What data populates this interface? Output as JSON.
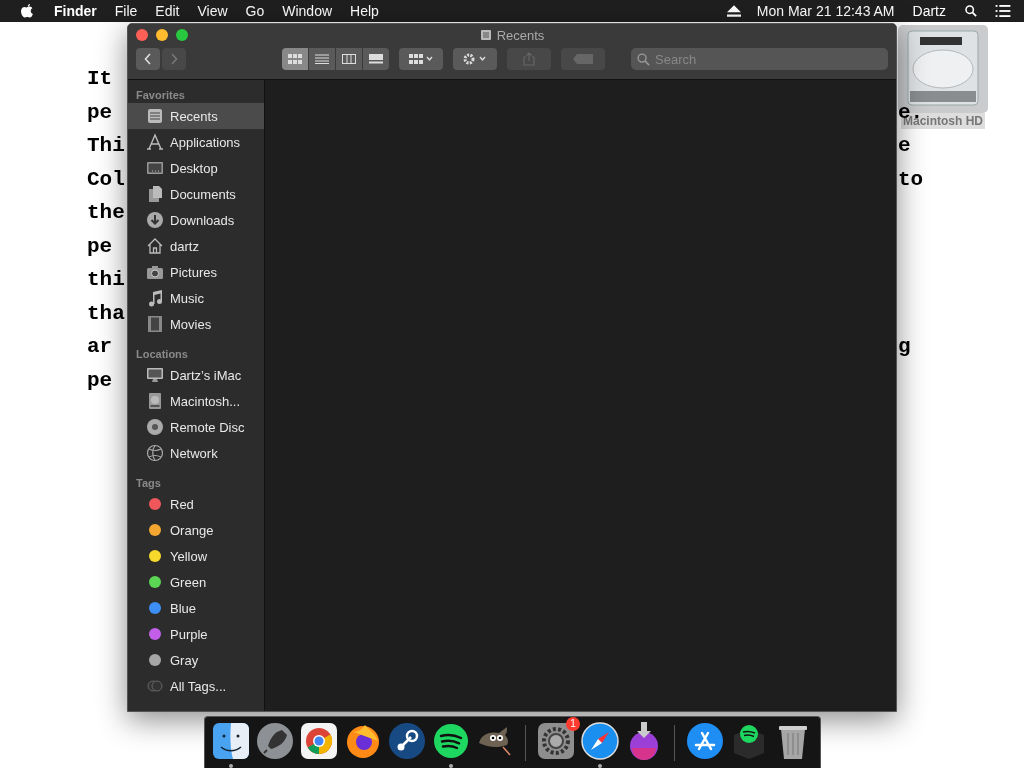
{
  "menu_bar": {
    "app_name": "Finder",
    "menus": [
      "File",
      "Edit",
      "View",
      "Go",
      "Window",
      "Help"
    ],
    "clock": "Mon Mar 21  12:43 AM",
    "user": "Dartz"
  },
  "desktop": {
    "text_lines": [
      {
        "left": "It"
      },
      {
        "left": "pe",
        "right": "e."
      },
      {
        "left": "Thi",
        "right": "e"
      },
      {
        "left": "Col",
        "right": "to"
      },
      {
        "left": "the"
      },
      {
        "left": "pe"
      },
      {
        "left": "thi"
      },
      {
        "left": "tha"
      },
      {
        "left": "ar",
        "right": "g"
      },
      {
        "left": "pe"
      }
    ],
    "icon": {
      "label": "Macintosh HD"
    }
  },
  "window": {
    "title": "Recents",
    "view_modes": [
      {
        "selected": true
      },
      {
        "selected": false
      },
      {
        "selected": false
      },
      {
        "selected": false
      }
    ],
    "search": {
      "placeholder": "Search"
    },
    "sidebar": [
      {
        "heading": "Favorites",
        "items": [
          {
            "label": "Recents",
            "selected": true
          },
          {
            "label": "Applications",
            "selected": false
          },
          {
            "label": "Desktop",
            "selected": false
          },
          {
            "label": "Documents",
            "selected": false
          },
          {
            "label": "Downloads",
            "selected": false
          },
          {
            "label": "dartz",
            "selected": false
          },
          {
            "label": "Pictures",
            "selected": false
          },
          {
            "label": "Music",
            "selected": false
          },
          {
            "label": "Movies",
            "selected": false
          }
        ]
      },
      {
        "heading": "Locations",
        "items": [
          {
            "label": "Dartz’s iMac",
            "selected": false
          },
          {
            "label": "Macintosh...",
            "selected": false
          },
          {
            "label": "Remote Disc",
            "selected": false
          },
          {
            "label": "Network",
            "selected": false
          }
        ]
      },
      {
        "heading": "Tags",
        "items": [
          {
            "label": "Red",
            "color": "#f0575a",
            "selected": false
          },
          {
            "label": "Orange",
            "color": "#f5a631",
            "selected": false
          },
          {
            "label": "Yellow",
            "color": "#f7d92b",
            "selected": false
          },
          {
            "label": "Green",
            "color": "#5ad654",
            "selected": false
          },
          {
            "label": "Blue",
            "color": "#3d8ff5",
            "selected": false
          },
          {
            "label": "Purple",
            "color": "#c25ee8",
            "selected": false
          },
          {
            "label": "Gray",
            "color": "#a6a6a6",
            "selected": false
          },
          {
            "label": "All Tags...",
            "selected": false
          }
        ]
      }
    ]
  },
  "dock": [
    {
      "running": true
    },
    {
      "running": false
    },
    {
      "running": false
    },
    {
      "running": false
    },
    {
      "running": false
    },
    {
      "running": true
    },
    {
      "running": false
    },
    {
      "running": false,
      "badge": "1"
    },
    {
      "running": true
    },
    {
      "running": false
    },
    {
      "running": false
    },
    {
      "running": false
    },
    {
      "running": false
    }
  ]
}
